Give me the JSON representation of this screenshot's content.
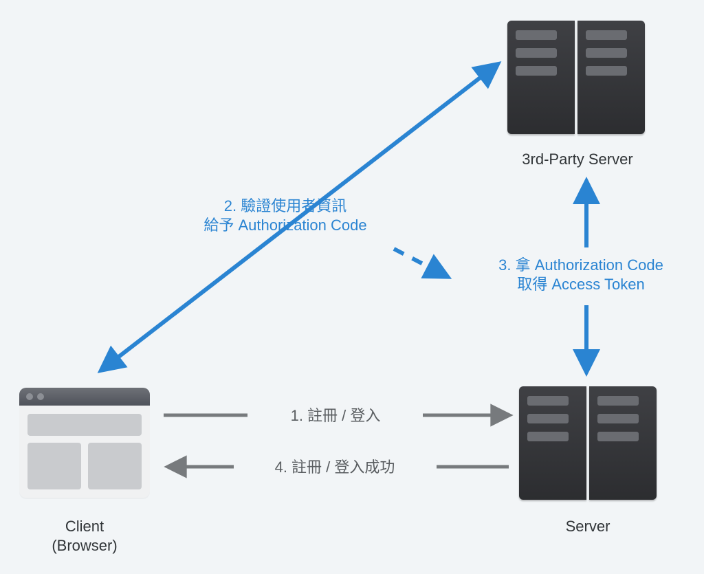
{
  "nodes": {
    "client": {
      "label": "Client\n(Browser)"
    },
    "server": {
      "label": "Server"
    },
    "third_party": {
      "label": "3rd-Party Server"
    }
  },
  "edges": {
    "step1": {
      "label": "1. 註冊 / 登入"
    },
    "step2": {
      "label": "2. 驗證使用者資訊\n給予 Authorization Code"
    },
    "step3": {
      "label": "3. 拿 Authorization Code\n取得 Access Token"
    },
    "step4": {
      "label": "4. 註冊 / 登入成功"
    }
  },
  "colors": {
    "accent": "#2a84d2",
    "ink": "#303437",
    "grayArrow": "#777a7d"
  }
}
